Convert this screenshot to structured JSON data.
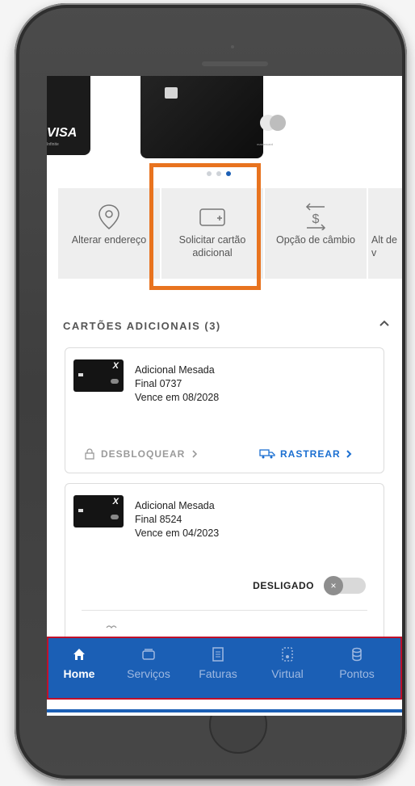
{
  "cards": {
    "visa_brand": "VISA",
    "visa_sub": "Infinite",
    "mastercard_label": "mastercard"
  },
  "carousel": {
    "count": 3,
    "active_index": 2
  },
  "actions": [
    {
      "label": "Alterar endereço",
      "icon": "location-pin-icon"
    },
    {
      "label": "Solicitar cartão adicional",
      "icon": "add-card-icon"
    },
    {
      "label": "Opção de câmbio",
      "icon": "currency-exchange-icon"
    },
    {
      "label": "Alt de v",
      "icon": "unknown-icon"
    }
  ],
  "section": {
    "title": "CARTÕES ADICIONAIS (3)",
    "chevron_icon": "chevron-up-icon"
  },
  "additional_cards": [
    {
      "name": "Adicional Mesada",
      "final": "Final 0737",
      "expiry": "Vence em 08/2028",
      "unlock_label": "DESBLOQUEAR",
      "track_label": "RASTREAR"
    },
    {
      "name": "Adicional Mesada",
      "final": "Final 8524",
      "expiry": "Vence em 04/2023",
      "toggle_label": "DESLIGADO",
      "toggle_on": false
    }
  ],
  "nav": [
    {
      "label": "Home",
      "icon": "home-icon",
      "active": true
    },
    {
      "label": "Serviços",
      "icon": "cards-icon",
      "active": false
    },
    {
      "label": "Faturas",
      "icon": "invoice-icon",
      "active": false
    },
    {
      "label": "Virtual",
      "icon": "virtual-card-icon",
      "active": false
    },
    {
      "label": "Pontos",
      "icon": "points-icon",
      "active": false
    }
  ],
  "colors": {
    "brand_blue": "#1b5fb5",
    "highlight_orange": "#e8731f",
    "link_blue": "#1b6fd1"
  }
}
